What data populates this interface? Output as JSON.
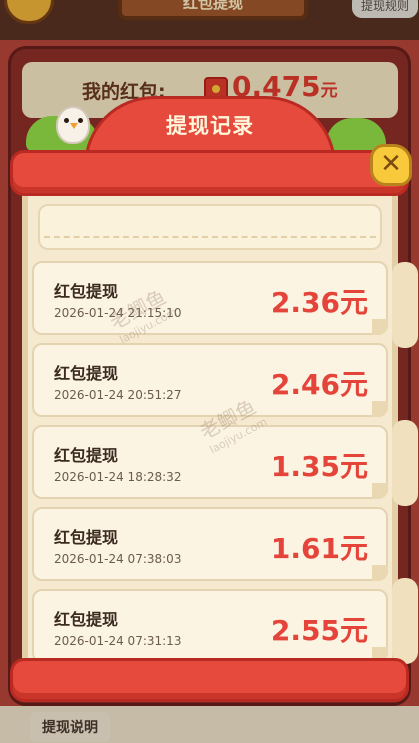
{
  "background": {
    "header_title": "红包提现",
    "rule_button": "提现规则",
    "balance_label": "我的红包:",
    "balance_amount": "0.475",
    "balance_unit": "元",
    "help_label": "提现说明"
  },
  "modal": {
    "title": "提现记录",
    "close_icon": "close-icon"
  },
  "records": [
    {
      "title": "红包提现",
      "time": "2026-01-24  21:15:10",
      "amount": "2.36元"
    },
    {
      "title": "红包提现",
      "time": "2026-01-24  20:51:27",
      "amount": "2.46元"
    },
    {
      "title": "红包提现",
      "time": "2026-01-24  18:28:32",
      "amount": "1.35元"
    },
    {
      "title": "红包提现",
      "time": "2026-01-24  07:38:03",
      "amount": "1.61元"
    },
    {
      "title": "红包提现",
      "time": "2026-01-24  07:31:13",
      "amount": "2.55元"
    }
  ],
  "watermark": {
    "text": "老鲫鱼",
    "sub": "laojiyu.com"
  },
  "colors": {
    "accent_red": "#e64a3c",
    "amount_red": "#e4443a",
    "paper": "#f5e9cf",
    "close_yellow": "#f8c93a"
  }
}
